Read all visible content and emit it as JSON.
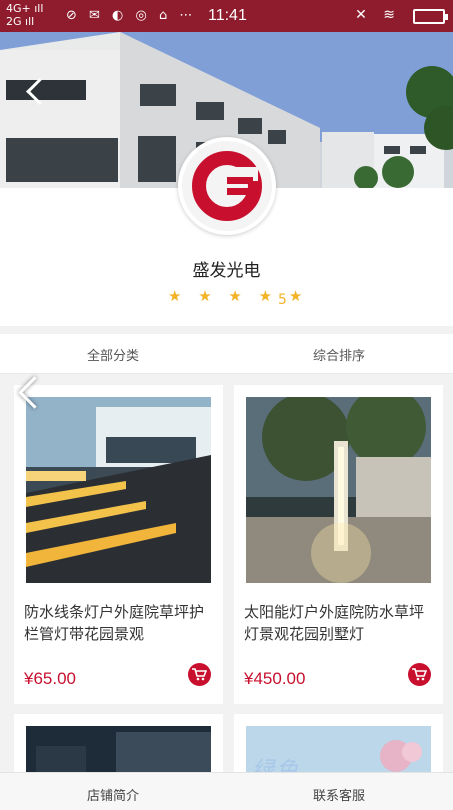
{
  "status_bar": {
    "network_top": "4G+",
    "network_bottom": "2G",
    "time": "11:41"
  },
  "store": {
    "name": "盛发光电",
    "stars": "★ ★ ★ ★ ★",
    "rating": "5",
    "logo_letter": "G",
    "brand_color": "#c8102e"
  },
  "tabs": {
    "all_categories": "全部分类",
    "sort": "综合排序"
  },
  "products": [
    {
      "title": "防水线条灯户外庭院草坪护栏管灯带花园景观",
      "price": "¥65.00"
    },
    {
      "title": "太阳能灯户外庭院防水草坪灯景观花园别墅灯",
      "price": "¥450.00"
    }
  ],
  "bottom_bar": {
    "store_intro": "店铺简介",
    "contact": "联系客服"
  },
  "watermark_text": "绿色"
}
